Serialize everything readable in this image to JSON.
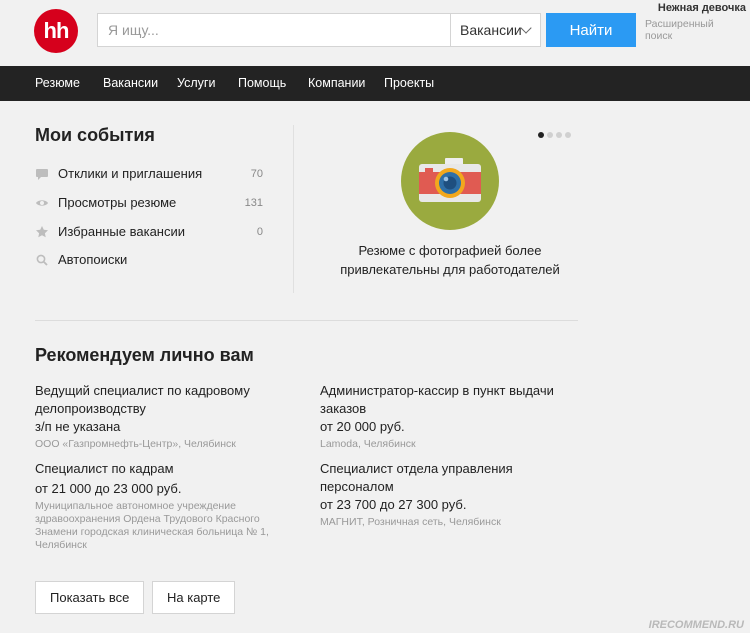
{
  "header": {
    "logo_text": "hh",
    "search_placeholder": "Я ищу...",
    "search_category": "Вакансии",
    "find_label": "Найти",
    "advanced_line1": "Расширенный",
    "advanced_line2": "поиск",
    "user_name": "Нежная девочка"
  },
  "nav": {
    "items": [
      "Резюме",
      "Вакансии",
      "Услуги",
      "Помощь",
      "Компании",
      "Проекты"
    ]
  },
  "events": {
    "title": "Мои события",
    "items": [
      {
        "label": "Отклики и приглашения",
        "count": "70",
        "icon": "comment-icon"
      },
      {
        "label": "Просмотры резюме",
        "count": "131",
        "icon": "eye-icon"
      },
      {
        "label": "Избранные вакансии",
        "count": "0",
        "icon": "star-icon"
      },
      {
        "label": "Автопоиски",
        "count": "",
        "icon": "search-icon"
      }
    ]
  },
  "promo": {
    "icon": "camera-icon",
    "line1": "Резюме с фотографией более",
    "line2": "привлекательны для работодателей",
    "slides_total": 4,
    "slides_active": 1
  },
  "recommend": {
    "title": "Рекомендуем лично вам",
    "vacancies": [
      {
        "title_lines": [
          "Ведущий специалист по кадровому",
          "делопроизводству"
        ],
        "salary": "з/п не указана",
        "company_lines": [
          "ООО «Газпромнефть-Центр», Челябинск"
        ]
      },
      {
        "title_lines": [
          "Администратор-кассир в пункт выдачи",
          "заказов"
        ],
        "salary": "от 20 000 руб.",
        "company_lines": [
          "Lamoda, Челябинск"
        ]
      },
      {
        "title_lines": [
          "Специалист по кадрам"
        ],
        "salary": "от 21 000 до 23 000 руб.",
        "company_lines": [
          "Муниципальное автономное учреждение",
          "здравоохранения Ордена Трудового Красного",
          "Знамени городская клиническая больница № 1,",
          "Челябинск"
        ]
      },
      {
        "title_lines": [
          "Специалист отдела управления",
          "персоналом"
        ],
        "salary": "от 23 700 до 27 300 руб.",
        "company_lines": [
          "МАГНИТ, Розничная сеть, Челябинск"
        ]
      }
    ],
    "show_all_label": "Показать все",
    "map_label": "На карте"
  },
  "watermark": "IRECOMMEND.RU",
  "colors": {
    "brand_red": "#d6001c",
    "accent_blue": "#2b9af3",
    "nav_bg": "#232323",
    "promo_green": "#9aaa3f"
  }
}
